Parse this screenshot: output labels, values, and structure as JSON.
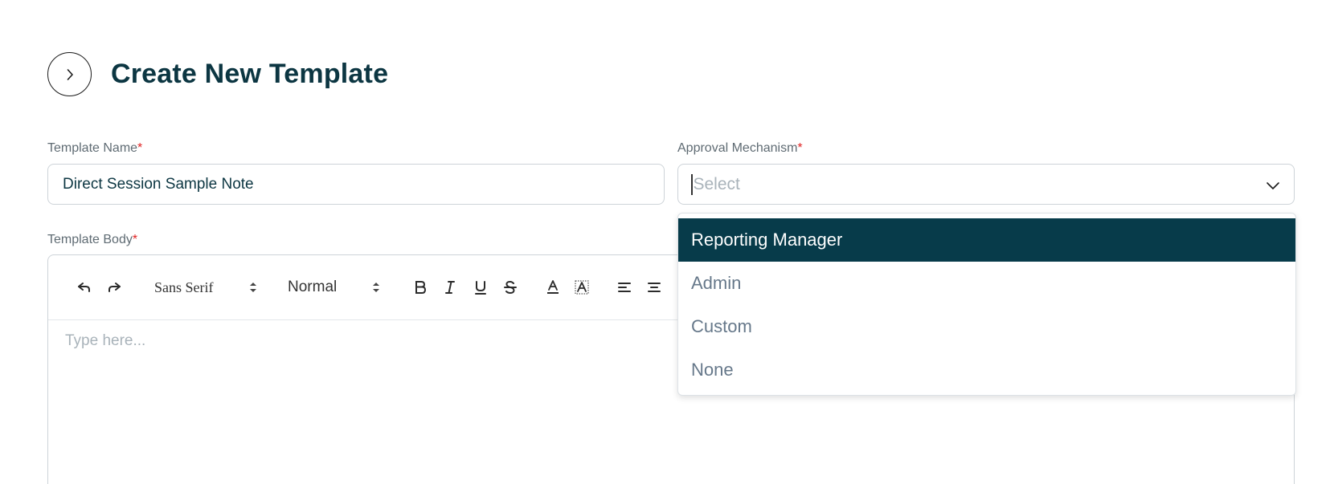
{
  "page": {
    "title": "Create New Template"
  },
  "form": {
    "template_name": {
      "label": "Template Name",
      "required_mark": "*",
      "value": "Direct Session Sample Note"
    },
    "approval_mechanism": {
      "label": "Approval Mechanism",
      "required_mark": "*",
      "placeholder": "Select",
      "options": [
        "Reporting Manager",
        "Admin",
        "Custom",
        "None"
      ],
      "highlighted_option": "Reporting Manager"
    },
    "template_body": {
      "label": "Template Body",
      "required_mark": "*",
      "placeholder": "Type here...",
      "toolbar": {
        "font_family": "Sans Serif",
        "font_size": "Normal",
        "icons": [
          "undo-icon",
          "redo-icon",
          "bold-icon",
          "italic-icon",
          "underline-icon",
          "strikethrough-icon",
          "text-color-icon",
          "background-color-icon",
          "align-left-icon",
          "align-center-icon"
        ]
      }
    }
  },
  "colors": {
    "primary_dark": "#073b4a",
    "title": "#0c3642",
    "required": "#e02424"
  }
}
